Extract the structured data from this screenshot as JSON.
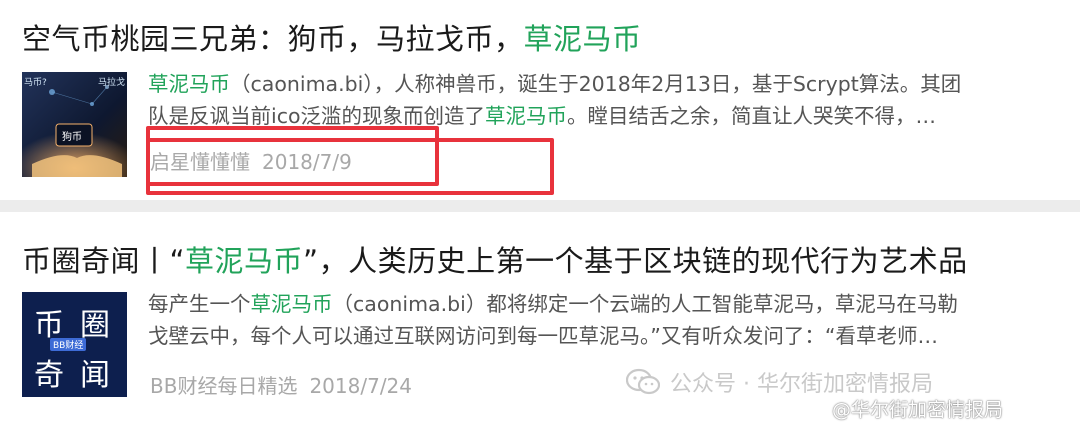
{
  "card1": {
    "title_prefix": "空气币桃园三兄弟：狗币，马拉戈币，",
    "title_highlight": "草泥马币",
    "snippet_line1_hl": "草泥马币",
    "snippet_line1_rest": "（caonima.bi），人称神兽币，诞生于2018年2月13日，基于Scrypt算法。其团",
    "snippet_line2_a": "队是反讽当前ico泛滥的现象而创造了",
    "snippet_line2_hl": "草泥马币",
    "snippet_line2_b": "。瞠目结舌之余，简直让人哭笑不得，…",
    "source": "启星懂懂懂",
    "date": "2018/7/9",
    "thumb_text": "狗币",
    "thumb_corner_left": "马币?",
    "thumb_corner_right": "马拉戈"
  },
  "card2": {
    "title_prefix": "币圈奇闻丨“",
    "title_highlight": "草泥马币",
    "title_suffix": "”，人类历史上第一个基于区块链的现代行为艺术品",
    "snippet_line1_a": "每产生一个",
    "snippet_line1_hl": "草泥马币",
    "snippet_line1_rest": "（caonima.bi）都将绑定一个云端的人工智能草泥马，草泥马在马勒",
    "snippet_line2": "戈壁云中，每个人可以通过互联网访问到每一匹草泥马。”又有听众发问了：“看草老师…",
    "source": "BB财经每日精选",
    "date": "2018/7/24",
    "thumb_chars": [
      "币",
      "圈",
      "奇",
      "闻"
    ],
    "thumb_badge": "BB财经"
  },
  "watermark": {
    "text": "公众号 · 华尔街加密情报局",
    "text2": "@华尔街加密情报局"
  },
  "colors": {
    "highlight": "#21a35a",
    "box": "#e8323c"
  }
}
